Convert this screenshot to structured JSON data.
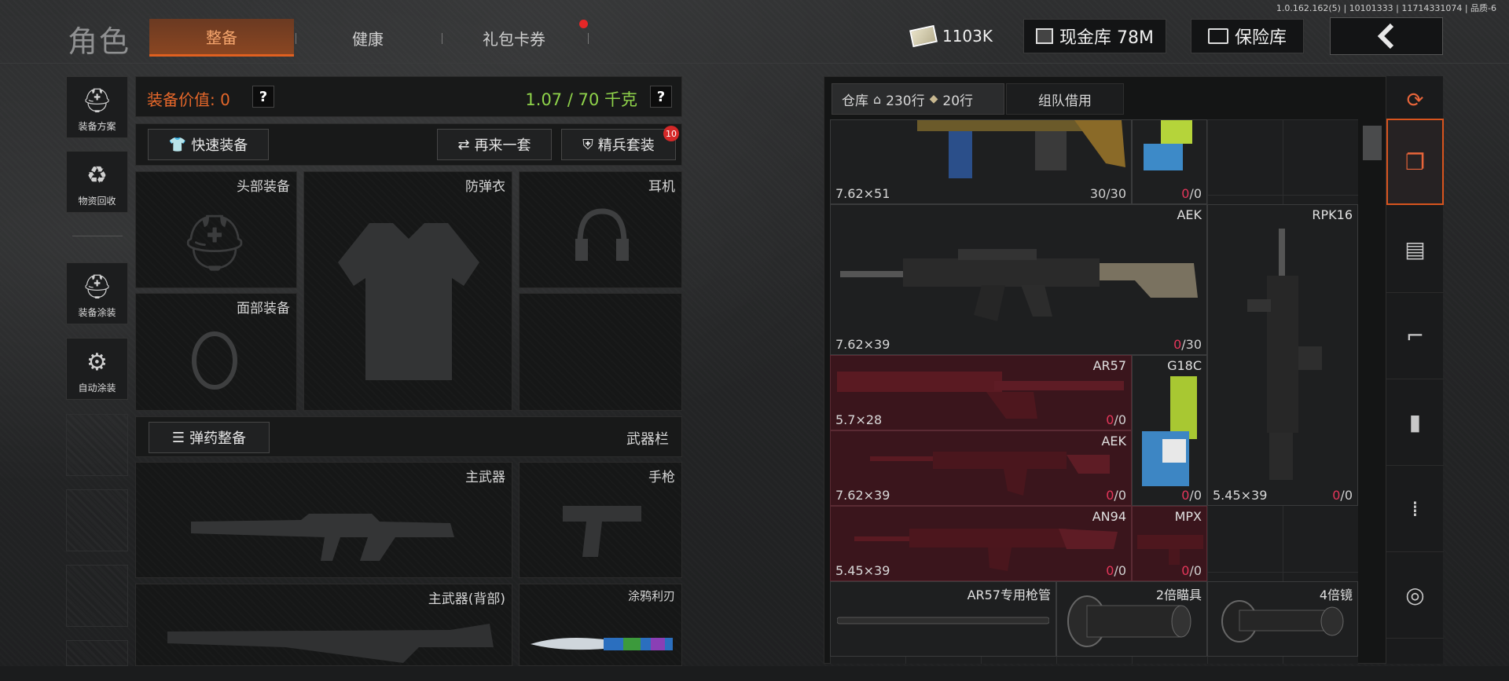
{
  "version": "1.0.162.162(5) | 10101333 | 11714331074 | 品质-6",
  "title": "角色",
  "tabs": [
    {
      "label": "整备"
    },
    {
      "label": "健康"
    },
    {
      "label": "礼包卡券"
    }
  ],
  "currency": {
    "cash": "1103K",
    "cash_vault": "现金库 78M",
    "safe": "保险库"
  },
  "sidebar": {
    "items": [
      {
        "label": "装备方案",
        "icon": "helmet-grid-icon"
      },
      {
        "label": "物资回收",
        "icon": "recycle-icon"
      },
      {
        "label": "装备涂装",
        "icon": "helmet-paint-icon"
      },
      {
        "label": "自动涂装",
        "icon": "brush-gear-icon"
      }
    ]
  },
  "loadout": {
    "value_label": "装备价值: 0",
    "weight": "1.07 / 70 千克",
    "help": "?",
    "quick_equip": "快速装备",
    "again": "再来一套",
    "elite": "精兵套装",
    "elite_badge": "10",
    "slots": {
      "head": "头部装备",
      "armor": "防弹衣",
      "headset": "耳机",
      "face": "面部装备",
      "primary": "主武器",
      "pistol": "手枪",
      "primary_back": "主武器(背部)",
      "knife": "涂鸦利刃"
    },
    "ammo_btn": "弹药整备",
    "weapon_bar": "武器栏"
  },
  "storage": {
    "tab_warehouse": "仓库",
    "warehouse_rows": "230行",
    "ticket_rows": "20行",
    "team_borrow": "组队借用",
    "items": [
      {
        "name": "",
        "caliber": "7.62×51",
        "ammo_cur": "30",
        "ammo_max": "/30",
        "red": false
      },
      {
        "name": "",
        "caliber": "",
        "ammo_cur": "0",
        "ammo_max": "/0",
        "red": false
      },
      {
        "name": "AEK",
        "caliber": "7.62×39",
        "ammo_cur": "0",
        "ammo_max": "/30",
        "red": false
      },
      {
        "name": "RPK16",
        "caliber": "5.45×39",
        "ammo_cur": "0",
        "ammo_max": "/0",
        "red": false
      },
      {
        "name": "AR57",
        "caliber": "5.7×28",
        "ammo_cur": "0",
        "ammo_max": "/0",
        "red": true
      },
      {
        "name": "G18C",
        "caliber": "",
        "ammo_cur": "0",
        "ammo_max": "/0",
        "red": false
      },
      {
        "name": "AEK",
        "caliber": "7.62×39",
        "ammo_cur": "0",
        "ammo_max": "/0",
        "red": true
      },
      {
        "name": "AN94",
        "caliber": "5.45×39",
        "ammo_cur": "0",
        "ammo_max": "/0",
        "red": true
      },
      {
        "name": "MPX",
        "caliber": "",
        "ammo_cur": "0",
        "ammo_max": "/0",
        "red": true
      },
      {
        "name": "AR57专用枪管",
        "caliber": "",
        "ammo_cur": "",
        "ammo_max": "",
        "red": false
      },
      {
        "name": "2倍瞄具",
        "caliber": "",
        "ammo_cur": "",
        "ammo_max": "",
        "red": false
      },
      {
        "name": "4倍镜",
        "caliber": "",
        "ammo_cur": "",
        "ammo_max": "",
        "red": false
      }
    ]
  },
  "categories": [
    {
      "icon": "stack-refresh-icon"
    },
    {
      "icon": "stack-icon"
    },
    {
      "icon": "vest-icon"
    },
    {
      "icon": "rifle-icon"
    },
    {
      "icon": "magazine-icon"
    },
    {
      "icon": "bullet-icon"
    },
    {
      "icon": "scope-icon"
    }
  ],
  "colors": {
    "accent": "#e06020",
    "weight_green": "#8fd34a",
    "value_orange": "#e5672a",
    "zero_red": "#e4365a"
  }
}
